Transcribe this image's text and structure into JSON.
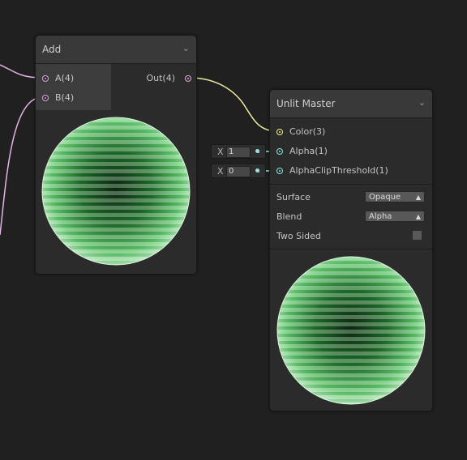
{
  "add_node": {
    "title": "Add",
    "inputs": [
      {
        "label": "A(4)",
        "color": "#e0a8e0"
      },
      {
        "label": "B(4)",
        "color": "#e0a8e0"
      }
    ],
    "output": {
      "label": "Out(4)",
      "color": "#e0a8e0"
    },
    "preview": "sphere-preview"
  },
  "master_node": {
    "title": "Unlit Master",
    "inputs": [
      {
        "label": "Color(3)",
        "color": "#f2f28a"
      },
      {
        "label": "Alpha(1)",
        "color": "#8ee6e6",
        "field_prefix": "X",
        "field_value": "1"
      },
      {
        "label": "AlphaClipThreshold(1)",
        "color": "#8ee6e6",
        "field_prefix": "X",
        "field_value": "0"
      }
    ],
    "properties": {
      "surface_label": "Surface",
      "surface_value": "Opaque",
      "blend_label": "Blend",
      "blend_value": "Alpha",
      "two_sided_label": "Two Sided",
      "two_sided_checked": false
    },
    "preview": "sphere-preview"
  },
  "colors": {
    "background": "#202020",
    "wire_vector4": "#e6b3e6",
    "wire_vector3": "#f5f2a0",
    "wire_vector1": "#8ee6e6",
    "sphere_green": "#2f9e3c"
  }
}
